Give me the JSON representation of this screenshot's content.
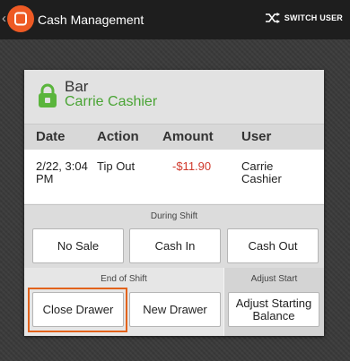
{
  "topbar": {
    "title": "Cash Management",
    "switch_user_label": "SWITCH USER"
  },
  "header": {
    "location": "Bar",
    "cashier": "Carrie Cashier"
  },
  "table": {
    "columns": [
      "Date",
      "Action",
      "Amount",
      "User"
    ],
    "rows": [
      {
        "date": "2/22, 3:04 PM",
        "action": "Tip Out",
        "amount": "-$11.90",
        "user": "Carrie Cashier"
      }
    ]
  },
  "during_shift": {
    "label": "During Shift",
    "buttons": [
      "No Sale",
      "Cash In",
      "Cash Out"
    ]
  },
  "end_of_shift": {
    "label": "End of Shift",
    "buttons": [
      "Close Drawer",
      "New Drawer"
    ]
  },
  "adjust_start": {
    "label": "Adjust Start",
    "button": "Adjust Starting Balance"
  },
  "colors": {
    "brand": "#ee5a24",
    "accent_green": "#4aa435",
    "negative_amount": "#d0392c",
    "selection_outline": "#e2621b"
  },
  "icons": [
    "chevron-left-icon",
    "app-logo-icon",
    "switch-user-icon",
    "lock-icon"
  ]
}
